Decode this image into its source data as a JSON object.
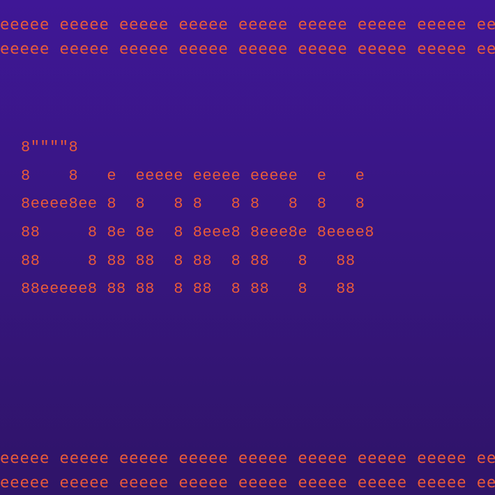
{
  "border": {
    "row": "eeeee eeeee eeeee eeeee eeeee eeeee eeeee eeeee eeeee eeeee e"
  },
  "ascii": {
    "l1": "8\"\"\"\"8",
    "l2": "8    8   e  eeeee eeeee eeeee  e   e",
    "l3": "8eeee8ee 8  8   8 8   8 8   8  8   8",
    "l4": "88     8 8e 8e  8 8eee8 8eee8e 8eeee8",
    "l5": "88     8 88 88  8 88  8 88   8   88",
    "l6": "88eeeee8 88 88  8 88  8 88   8   88"
  }
}
